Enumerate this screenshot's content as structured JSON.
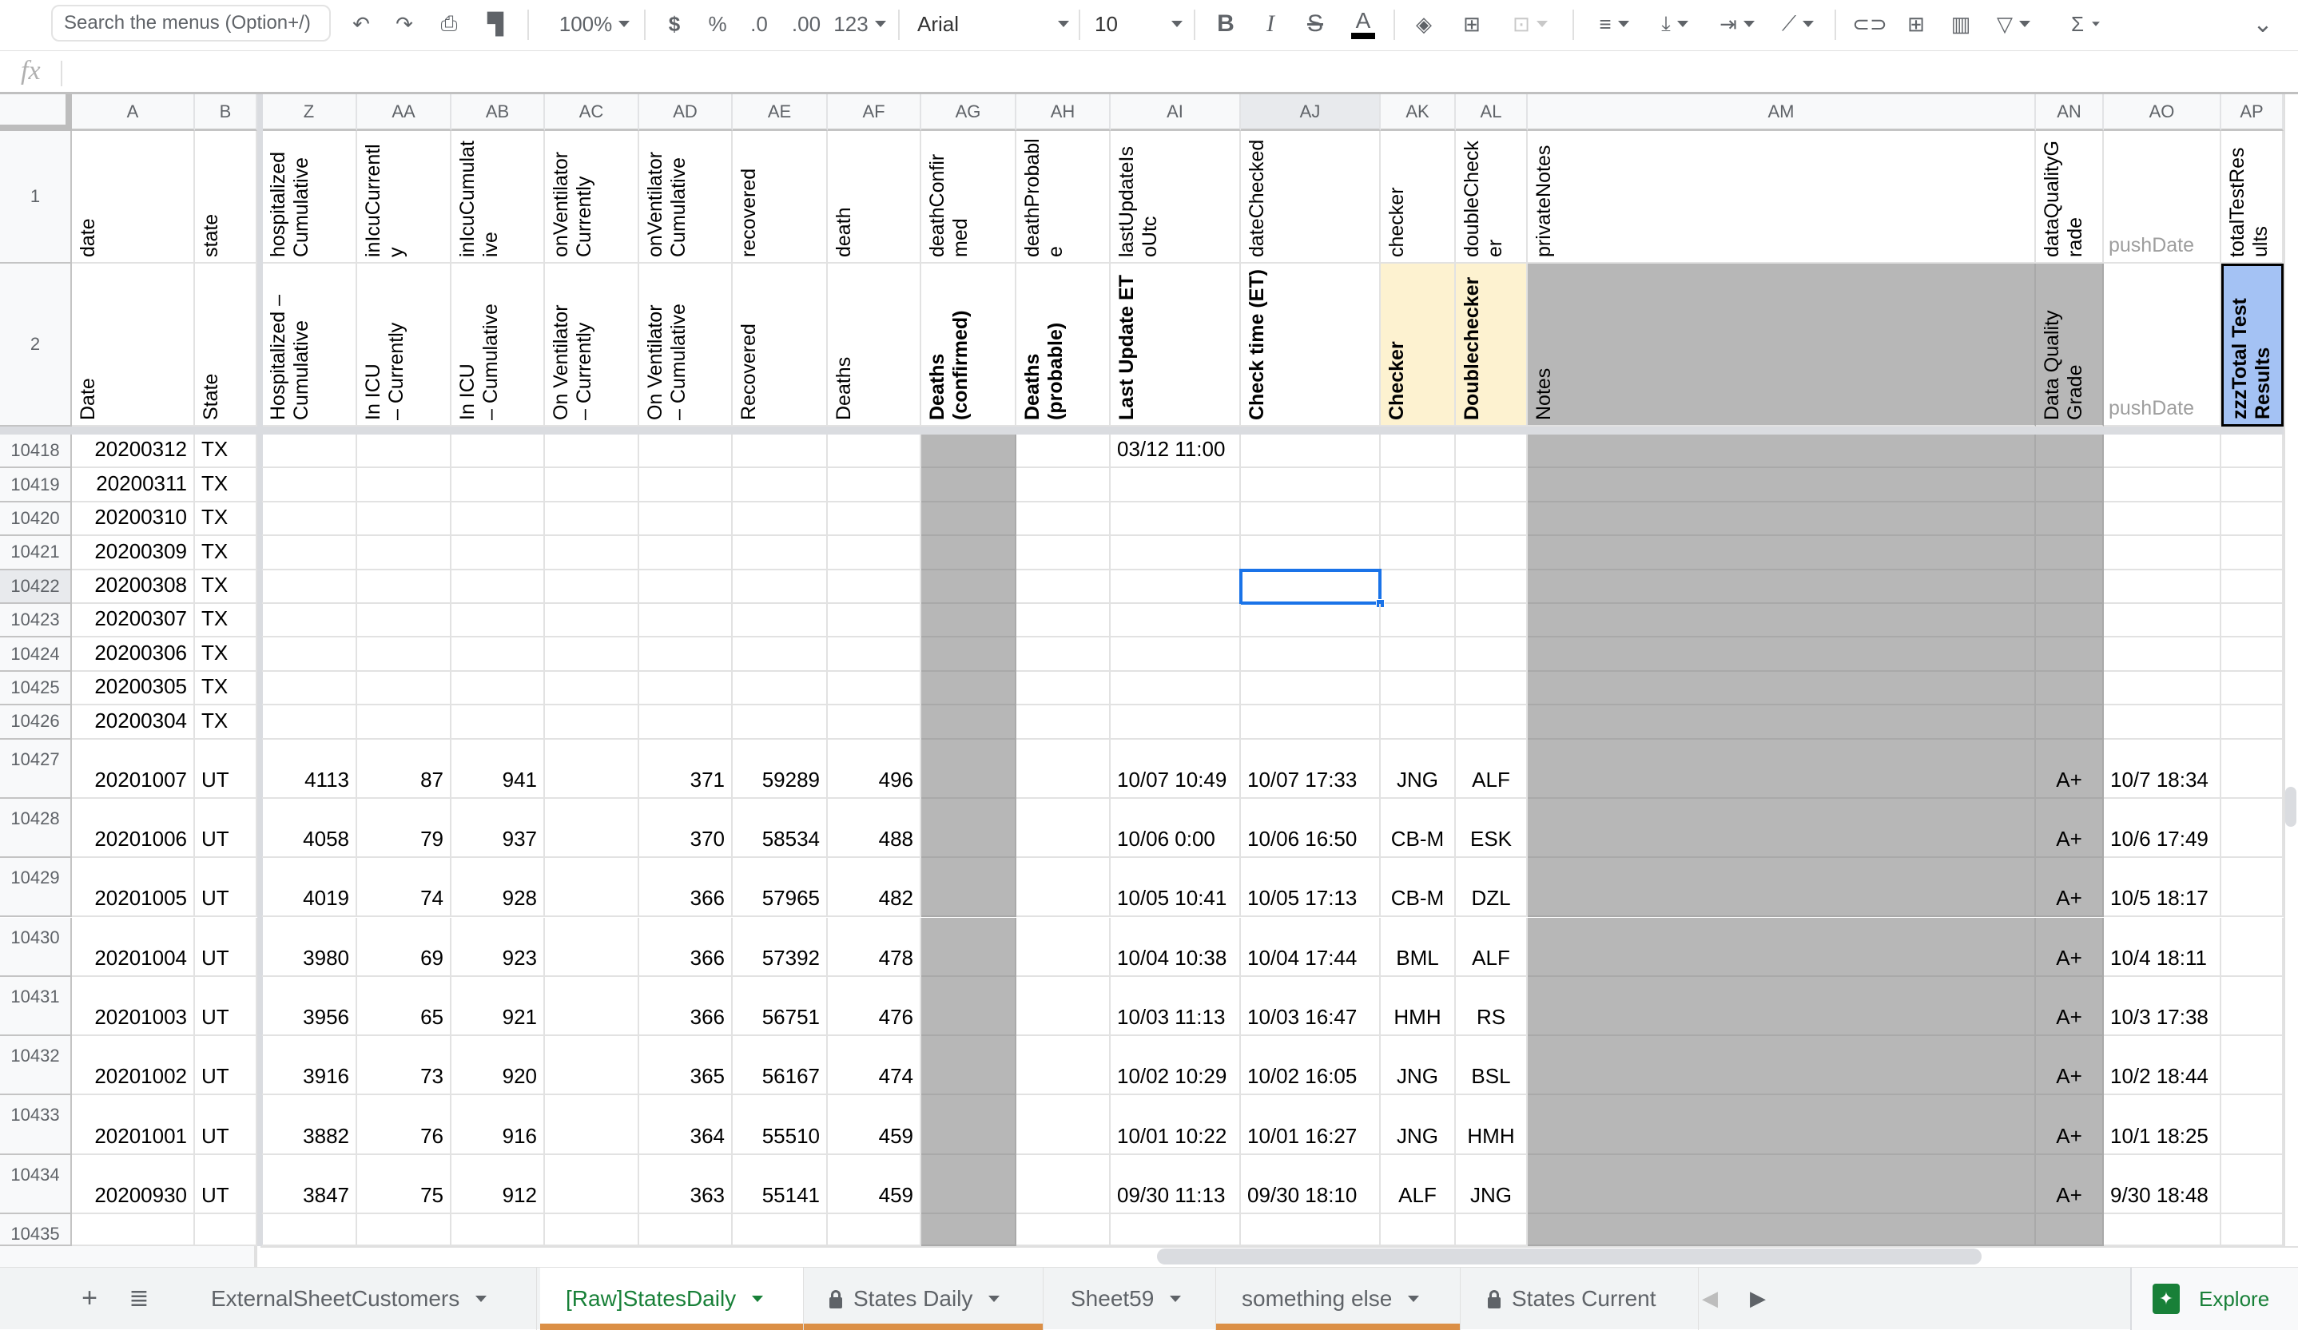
{
  "toolbar": {
    "search_placeholder": "Search the menus (Option+/)",
    "zoom": "100%",
    "currency": "$",
    "percent": "%",
    "decrease_decimal": ".0",
    "increase_decimal": ".00",
    "number_format": "123",
    "font": "Arial",
    "font_size": "10",
    "bold": "B",
    "italic": "I",
    "strikethrough": "S",
    "text_color": "A",
    "function": "Σ"
  },
  "formula_bar": {
    "fx_label": "fx",
    "value": ""
  },
  "columns": [
    "A",
    "B",
    "Z",
    "AA",
    "AB",
    "AC",
    "AD",
    "AE",
    "AF",
    "AG",
    "AH",
    "AI",
    "AJ",
    "AK",
    "AL",
    "AM",
    "AN",
    "AO",
    "AP"
  ],
  "selected_column": "AJ",
  "header_row1": {
    "row_number": "1",
    "cells": [
      "date",
      "state",
      "hospitalized\nCumulative",
      "inIcuCurrentl\ny",
      "inIcuCumulat\nive",
      "onVentilator\nCurrently",
      "onVentilator\nCumulative",
      "recovered",
      "death",
      "deathConfir\nmed",
      "deathProbabl\ne",
      "lastUpdateIs\noUtc",
      "dateChecked",
      "checker",
      "doubleCheck\ner",
      "privateNotes",
      "dataQualityG\nrade",
      "pushDate",
      "totalTestRes\nults"
    ]
  },
  "header_row2": {
    "row_number": "2",
    "cells": [
      "Date",
      "State",
      "Hospitalized –\nCumulative",
      "In ICU\n– Currently",
      "In ICU\n– Cumulative",
      "On Ventilator\n– Currently",
      "On Ventilator\n– Cumulative",
      "Recovered",
      "Deaths",
      "Deaths\n(confirmed)",
      "Deaths\n(probable)",
      "Last Update ET",
      "Check time (ET)",
      "Checker",
      "Doublechecker",
      "Notes",
      "Data Quality\nGrade",
      "pushDate",
      "zzzTotal Test\nResults"
    ]
  },
  "rows": [
    {
      "n": "10418",
      "date": "20200312",
      "state": "TX",
      "Z": "",
      "AA": "",
      "AB": "",
      "AC": "",
      "AD": "",
      "AE": "",
      "AF": "",
      "AI": "03/12 11:00",
      "AJ": "",
      "AK": "",
      "AL": "",
      "AN": "",
      "AO": ""
    },
    {
      "n": "10419",
      "date": "20200311",
      "state": "TX",
      "Z": "",
      "AA": "",
      "AB": "",
      "AC": "",
      "AD": "",
      "AE": "",
      "AF": "",
      "AI": "",
      "AJ": "",
      "AK": "",
      "AL": "",
      "AN": "",
      "AO": ""
    },
    {
      "n": "10420",
      "date": "20200310",
      "state": "TX",
      "Z": "",
      "AA": "",
      "AB": "",
      "AC": "",
      "AD": "",
      "AE": "",
      "AF": "",
      "AI": "",
      "AJ": "",
      "AK": "",
      "AL": "",
      "AN": "",
      "AO": ""
    },
    {
      "n": "10421",
      "date": "20200309",
      "state": "TX",
      "Z": "",
      "AA": "",
      "AB": "",
      "AC": "",
      "AD": "",
      "AE": "",
      "AF": "",
      "AI": "",
      "AJ": "",
      "AK": "",
      "AL": "",
      "AN": "",
      "AO": ""
    },
    {
      "n": "10422",
      "date": "20200308",
      "state": "TX",
      "Z": "",
      "AA": "",
      "AB": "",
      "AC": "",
      "AD": "",
      "AE": "",
      "AF": "",
      "AI": "",
      "AJ": "",
      "AK": "",
      "AL": "",
      "AN": "",
      "AO": ""
    },
    {
      "n": "10423",
      "date": "20200307",
      "state": "TX",
      "Z": "",
      "AA": "",
      "AB": "",
      "AC": "",
      "AD": "",
      "AE": "",
      "AF": "",
      "AI": "",
      "AJ": "",
      "AK": "",
      "AL": "",
      "AN": "",
      "AO": ""
    },
    {
      "n": "10424",
      "date": "20200306",
      "state": "TX",
      "Z": "",
      "AA": "",
      "AB": "",
      "AC": "",
      "AD": "",
      "AE": "",
      "AF": "",
      "AI": "",
      "AJ": "",
      "AK": "",
      "AL": "",
      "AN": "",
      "AO": ""
    },
    {
      "n": "10425",
      "date": "20200305",
      "state": "TX",
      "Z": "",
      "AA": "",
      "AB": "",
      "AC": "",
      "AD": "",
      "AE": "",
      "AF": "",
      "AI": "",
      "AJ": "",
      "AK": "",
      "AL": "",
      "AN": "",
      "AO": ""
    },
    {
      "n": "10426",
      "date": "20200304",
      "state": "TX",
      "Z": "",
      "AA": "",
      "AB": "",
      "AC": "",
      "AD": "",
      "AE": "",
      "AF": "",
      "AI": "",
      "AJ": "",
      "AK": "",
      "AL": "",
      "AN": "",
      "AO": ""
    },
    {
      "n": "10427",
      "date": "20201007",
      "state": "UT",
      "Z": "4113",
      "AA": "87",
      "AB": "941",
      "AC": "",
      "AD": "371",
      "AE": "59289",
      "AF": "496",
      "AI": "10/07 10:49",
      "AJ": "10/07 17:33",
      "AK": "JNG",
      "AL": "ALF",
      "AN": "A+",
      "AO": "10/7 18:34"
    },
    {
      "n": "10428",
      "date": "20201006",
      "state": "UT",
      "Z": "4058",
      "AA": "79",
      "AB": "937",
      "AC": "",
      "AD": "370",
      "AE": "58534",
      "AF": "488",
      "AI": "10/06 0:00",
      "AJ": "10/06 16:50",
      "AK": "CB-M",
      "AL": "ESK",
      "AN": "A+",
      "AO": "10/6 17:49"
    },
    {
      "n": "10429",
      "date": "20201005",
      "state": "UT",
      "Z": "4019",
      "AA": "74",
      "AB": "928",
      "AC": "",
      "AD": "366",
      "AE": "57965",
      "AF": "482",
      "AI": "10/05 10:41",
      "AJ": "10/05 17:13",
      "AK": "CB-M",
      "AL": "DZL",
      "AN": "A+",
      "AO": "10/5 18:17"
    },
    {
      "n": "10430",
      "date": "20201004",
      "state": "UT",
      "Z": "3980",
      "AA": "69",
      "AB": "923",
      "AC": "",
      "AD": "366",
      "AE": "57392",
      "AF": "478",
      "AI": "10/04 10:38",
      "AJ": "10/04 17:44",
      "AK": "BML",
      "AL": "ALF",
      "AN": "A+",
      "AO": "10/4 18:11"
    },
    {
      "n": "10431",
      "date": "20201003",
      "state": "UT",
      "Z": "3956",
      "AA": "65",
      "AB": "921",
      "AC": "",
      "AD": "366",
      "AE": "56751",
      "AF": "476",
      "AI": "10/03 11:13",
      "AJ": "10/03 16:47",
      "AK": "HMH",
      "AL": "RS",
      "AN": "A+",
      "AO": "10/3 17:38"
    },
    {
      "n": "10432",
      "date": "20201002",
      "state": "UT",
      "Z": "3916",
      "AA": "73",
      "AB": "920",
      "AC": "",
      "AD": "365",
      "AE": "56167",
      "AF": "474",
      "AI": "10/02 10:29",
      "AJ": "10/02 16:05",
      "AK": "JNG",
      "AL": "BSL",
      "AN": "A+",
      "AO": "10/2 18:44"
    },
    {
      "n": "10433",
      "date": "20201001",
      "state": "UT",
      "Z": "3882",
      "AA": "76",
      "AB": "916",
      "AC": "",
      "AD": "364",
      "AE": "55510",
      "AF": "459",
      "AI": "10/01 10:22",
      "AJ": "10/01 16:27",
      "AK": "JNG",
      "AL": "HMH",
      "AN": "A+",
      "AO": "10/1 18:25"
    },
    {
      "n": "10434",
      "date": "20200930",
      "state": "UT",
      "Z": "3847",
      "AA": "75",
      "AB": "912",
      "AC": "",
      "AD": "363",
      "AE": "55141",
      "AF": "459",
      "AI": "09/30 11:13",
      "AJ": "09/30 18:10",
      "AK": "ALF",
      "AL": "JNG",
      "AN": "A+",
      "AO": "9/30 18:48"
    },
    {
      "n": "10435",
      "date": "",
      "state": "",
      "Z": "",
      "AA": "",
      "AB": "",
      "AC": "",
      "AD": "",
      "AE": "",
      "AF": "",
      "AI": "",
      "AJ": "",
      "AK": "",
      "AL": "",
      "AN": "",
      "AO": ""
    }
  ],
  "selected_cell": "AJ10422",
  "sheet_tabs": [
    {
      "label": "ExternalSheetCustomers",
      "locked": false,
      "active": false,
      "colored": false
    },
    {
      "label": "[Raw]StatesDaily",
      "locked": false,
      "active": true,
      "colored": true
    },
    {
      "label": "States Daily",
      "locked": true,
      "active": false,
      "colored": true
    },
    {
      "label": "Sheet59",
      "locked": false,
      "active": false,
      "colored": false
    },
    {
      "label": "something else",
      "locked": false,
      "active": false,
      "colored": true
    },
    {
      "label": "States Current",
      "locked": true,
      "active": false,
      "colored": false
    }
  ],
  "tab_color": "#db8f46",
  "active_tab_text_color": "#188038",
  "explore_label": "Explore"
}
